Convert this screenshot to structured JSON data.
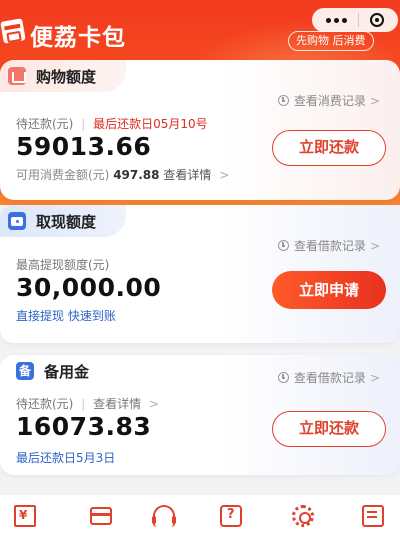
{
  "header": {
    "app_title": "便荔卡包",
    "slogan": "先购物 后消费"
  },
  "shopping": {
    "title": "购物额度",
    "record_link": "查看消费记录",
    "pending_label": "待还款(元)",
    "due_label": "最后还款日05月10号",
    "amount": "59013.66",
    "available_label": "可用消费金额(元)",
    "available_value": "497.88",
    "detail_link": "查看详情",
    "button": "立即还款"
  },
  "cash": {
    "title": "取现额度",
    "record_link": "查看借款记录",
    "max_label": "最高提现额度(元)",
    "amount": "30,000.00",
    "tagline": "直接提现 快速到账",
    "button": "立即申请"
  },
  "reserve": {
    "title": "备用金",
    "icon_char": "备",
    "record_link": "查看借款记录",
    "pending_label": "待还款(元)",
    "detail_link": "查看详情",
    "amount": "16073.83",
    "due_label": "最后还款日5月3日",
    "button": "立即还款"
  },
  "colors": {
    "brand_red": "#e0412d",
    "hero_top": "#f23a1f",
    "hero_bottom": "#f9842f",
    "link_blue": "#2f63c8"
  },
  "bottom_nav": {
    "icons": [
      "bill-icon",
      "card-icon",
      "support-icon",
      "help-icon",
      "settings-icon",
      "edit-icon"
    ]
  }
}
